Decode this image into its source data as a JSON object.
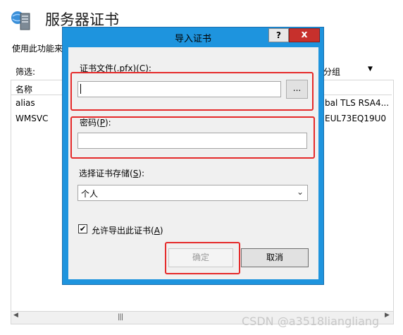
{
  "background": {
    "title": "服务器证书",
    "description": "使用此功能来",
    "filter_label": "筛选:",
    "group_label": "分组",
    "column_name": "名称",
    "rows": [
      {
        "name": "alias",
        "right": "bal TLS RSA4..."
      },
      {
        "name": "WMSVC",
        "right": "EUL73EQ19U0"
      }
    ]
  },
  "dialog": {
    "title": "导入证书",
    "help_label": "?",
    "close_label": "x",
    "file_label_prefix": "证书文件(.pfx)(",
    "file_label_key": "C",
    "file_label_suffix": "):",
    "file_value": "",
    "browse_label": "...",
    "password_label_prefix": "密码(",
    "password_label_key": "P",
    "password_label_suffix": "):",
    "password_value": "",
    "store_label_prefix": "选择证书存储(",
    "store_label_key": "S",
    "store_label_suffix": "):",
    "store_value": "个人",
    "allow_export_checked": true,
    "allow_export_prefix": "允许导出此证书(",
    "allow_export_key": "A",
    "allow_export_suffix": ")",
    "ok_label": "确定",
    "cancel_label": "取消"
  },
  "watermark": "CSDN @a3518liangliang",
  "colors": {
    "dialog_frame": "#1e94de",
    "close_button": "#c7302c",
    "highlight": "#e52a2a"
  },
  "icons": [
    "server-certificate-icon",
    "chevron-down-icon",
    "checkmark-icon",
    "scroll-left-icon",
    "scroll-right-icon"
  ]
}
